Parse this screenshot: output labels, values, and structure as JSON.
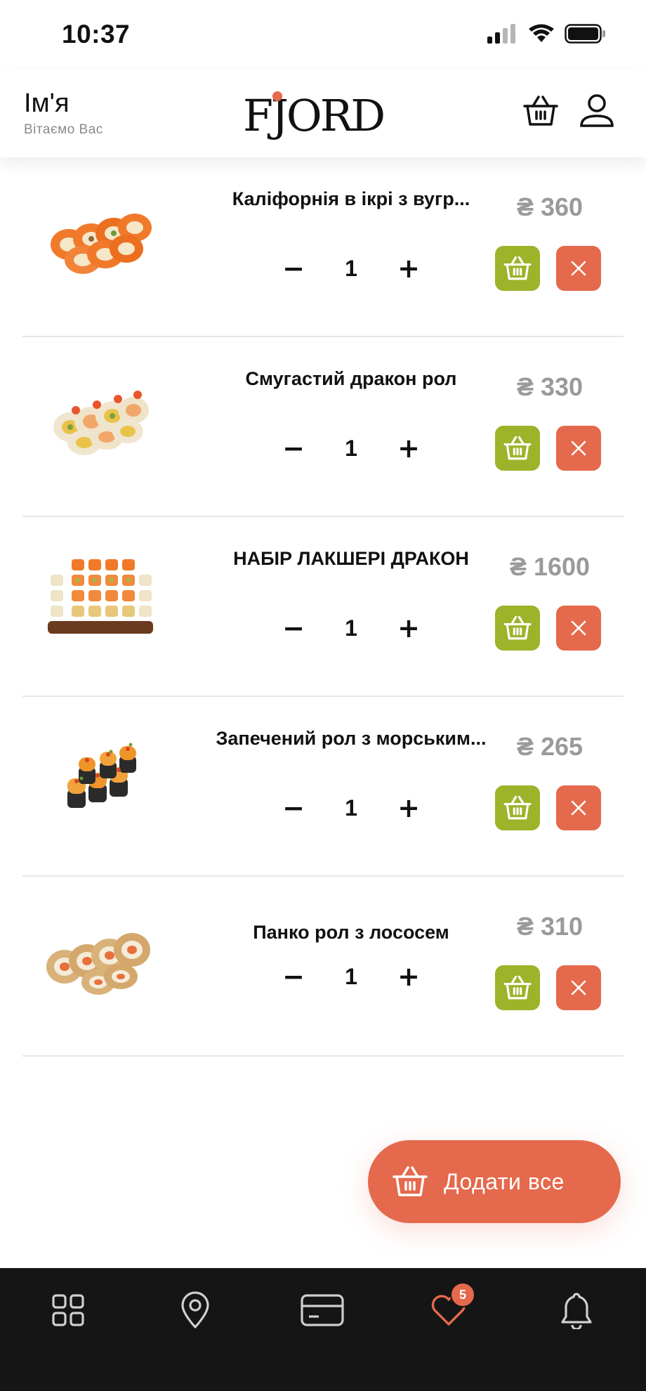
{
  "status_bar": {
    "time": "10:37"
  },
  "header": {
    "user_name": "Ім'я",
    "greeting": "Вітаємо Вас",
    "logo_text": "FJORD"
  },
  "currency_symbol": "₴",
  "items": [
    {
      "name": "Каліфорнія в ікрі з вугр...",
      "quantity": "1",
      "price": "₴ 360"
    },
    {
      "name": "Смугастий дракон рол",
      "quantity": "1",
      "price": "₴ 330"
    },
    {
      "name": "НАБІР ЛАКШЕРІ ДРАКОН",
      "quantity": "1",
      "price": "₴ 1600"
    },
    {
      "name": "Запечений рол з морським...",
      "quantity": "1",
      "price": "₴ 265"
    },
    {
      "name": "Панко рол з лососем",
      "quantity": "1",
      "price": "₴ 310"
    }
  ],
  "qty_controls": {
    "minus": "−",
    "plus": "+"
  },
  "add_all_button": {
    "label": "Додати все"
  },
  "bottom_nav": {
    "items": [
      {
        "icon": "grid-icon"
      },
      {
        "icon": "location-pin-icon"
      },
      {
        "icon": "card-icon"
      },
      {
        "icon": "heart-icon",
        "badge": "5",
        "active": true
      },
      {
        "icon": "bell-icon"
      }
    ]
  },
  "colors": {
    "accent": "#e5694c",
    "green": "#9db32a",
    "price_gray": "#9a9a9a",
    "nav_bg": "#151515"
  }
}
